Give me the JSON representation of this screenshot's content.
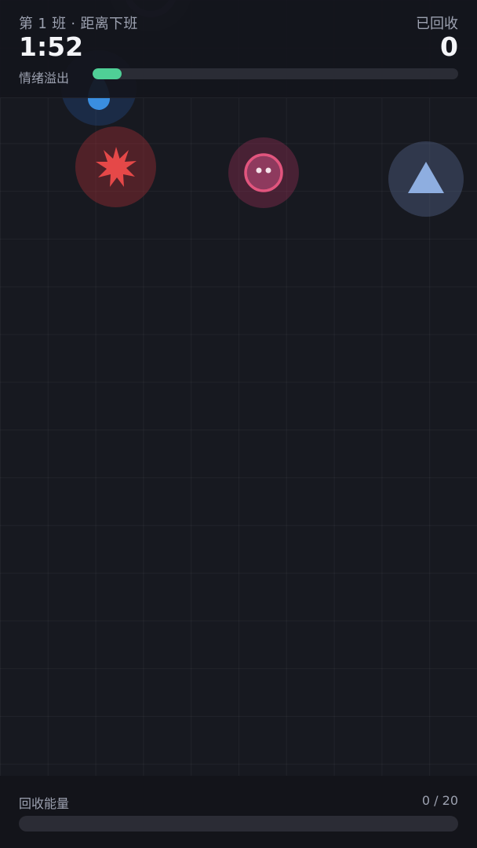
{
  "hud": {
    "shift_label": "第 1 班 · 距离下班",
    "timer": "1:52",
    "recovered_label": "已回收",
    "recovered_count": "0",
    "overflow_label": "情绪溢出",
    "overflow_level": 0.08
  },
  "bubbles": [
    {
      "name": "dark-emotion-bubble",
      "icon": "dark-ring-icon",
      "color": "#2a2a3a"
    },
    {
      "name": "sad-emotion-bubble",
      "icon": "teardrop-icon",
      "color": "#3a8ee0"
    },
    {
      "name": "anger-emotion-bubble",
      "icon": "starburst-icon",
      "color": "#e54848"
    },
    {
      "name": "anxious-emotion-bubble",
      "icon": "round-face-icon",
      "color": "#e2557e"
    },
    {
      "name": "calm-emotion-bubble",
      "icon": "triangle-icon",
      "color": "#8eaee0"
    }
  ],
  "energy": {
    "label": "回收能量",
    "current": 0,
    "total": 20,
    "count_text": "0 / 20"
  },
  "colors": {
    "background": "#171920",
    "hud_background": "#14151c",
    "accent_green": "#4fcf96",
    "track": "#2a2c35"
  }
}
